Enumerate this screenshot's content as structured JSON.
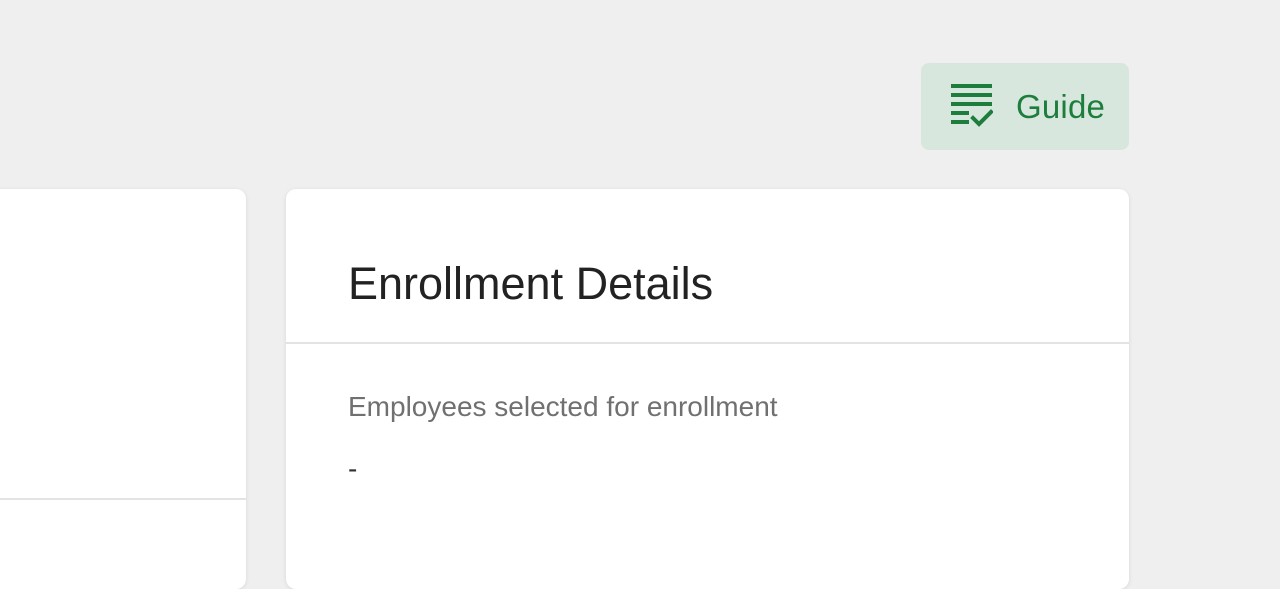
{
  "guide_button": {
    "icon": "checklist-icon",
    "label": "Guide",
    "accent_color": "#1c7d3c",
    "background_color": "#d8e7de"
  },
  "enrollment_details": {
    "title": "Enrollment Details",
    "fields": [
      {
        "label": "Employees selected for enrollment",
        "value": "-"
      }
    ]
  }
}
